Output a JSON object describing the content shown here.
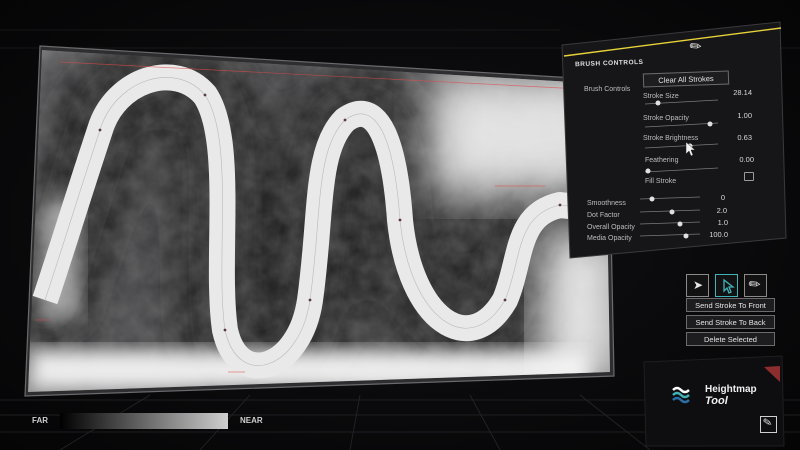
{
  "legend": {
    "far_label": "FAR",
    "near_label": "NEAR"
  },
  "brush_panel": {
    "title": "BRUSH CONTROLS",
    "section_label": "Brush Controls",
    "clear_button": "Clear All Strokes",
    "stroke_size": {
      "label": "Stroke Size",
      "value": "28.14",
      "level": 0.15
    },
    "stroke_opacity": {
      "label": "Stroke Opacity",
      "value": "1.00",
      "level": 1.0
    },
    "stroke_brightness": {
      "label": "Stroke Brightness",
      "value": "0.63",
      "level": 0.63
    },
    "feathering": {
      "label": "Feathering",
      "value": "0.00",
      "level": 0.0
    },
    "fill_stroke": {
      "label": "Fill Stroke",
      "checked": false
    },
    "smoothness": {
      "label": "Smoothness",
      "value": "0",
      "level": 0.0
    },
    "dot_factor": {
      "label": "Dot Factor",
      "value": "2.0",
      "level": 0.35
    },
    "overall_opacity": {
      "label": "Overall Opacity",
      "value": "1.0",
      "level": 0.55
    },
    "media_opacity": {
      "label": "Media Opacity",
      "value": "100.0",
      "level": 0.65
    },
    "brush_icon": "paintbrush-icon"
  },
  "tools": {
    "items": [
      {
        "name": "pointer-icon",
        "active": false
      },
      {
        "name": "select-pointer-icon",
        "active": true
      },
      {
        "name": "paintbrush-icon",
        "active": false
      }
    ],
    "send_front": "Send Stroke To Front",
    "send_back": "Send Stroke To Back",
    "delete": "Delete Selected"
  },
  "tool_card": {
    "title_line1": "Heightmap",
    "title_line2": "Tool",
    "logo_icon": "heightmap-logo-icon",
    "edit_icon": "edit-pencil-icon"
  },
  "colors": {
    "accent_teal": "#3fb3b8",
    "accent_yellow": "#e8d23a",
    "stroke_white": "#e9e9e9",
    "selection_red": "#e04a4a"
  }
}
